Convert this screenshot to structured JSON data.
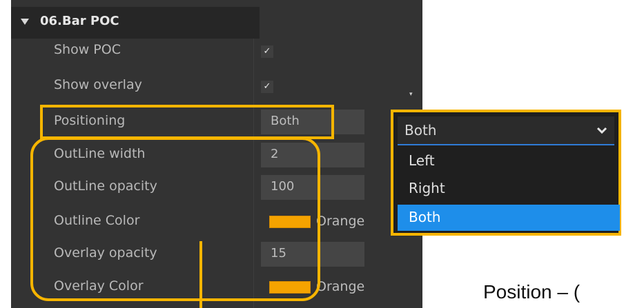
{
  "section": {
    "title": "06.Bar POC"
  },
  "rows": {
    "show_poc": {
      "label": "Show POC",
      "checked": true,
      "check_glyph": "✓"
    },
    "show_overlay": {
      "label": "Show overlay",
      "checked": true,
      "check_glyph": "✓"
    },
    "positioning": {
      "label": "Positioning",
      "value": "Both"
    },
    "outline_width": {
      "label": "OutLine width",
      "value": "2"
    },
    "outline_opacity": {
      "label": "OutLine opacity",
      "value": "100"
    },
    "outline_color": {
      "label": "Outline Color",
      "color": "#f5a300",
      "color_name": "Orange"
    },
    "overlay_opacity": {
      "label": "Overlay opacity",
      "value": "15"
    },
    "overlay_color": {
      "label": "Overlay Color",
      "color": "#f5a300",
      "color_name": "Orange"
    }
  },
  "dropdown": {
    "selected": "Both",
    "options": [
      "Left",
      "Right",
      "Both"
    ],
    "active_option": "Both",
    "chevron_icon": "chevron-down-icon"
  },
  "caption": "Position – (",
  "colors": {
    "highlight": "#f7b500",
    "panel_bg": "#333333",
    "active_option_bg": "#1e8eea",
    "swatch_orange": "#f5a300"
  }
}
